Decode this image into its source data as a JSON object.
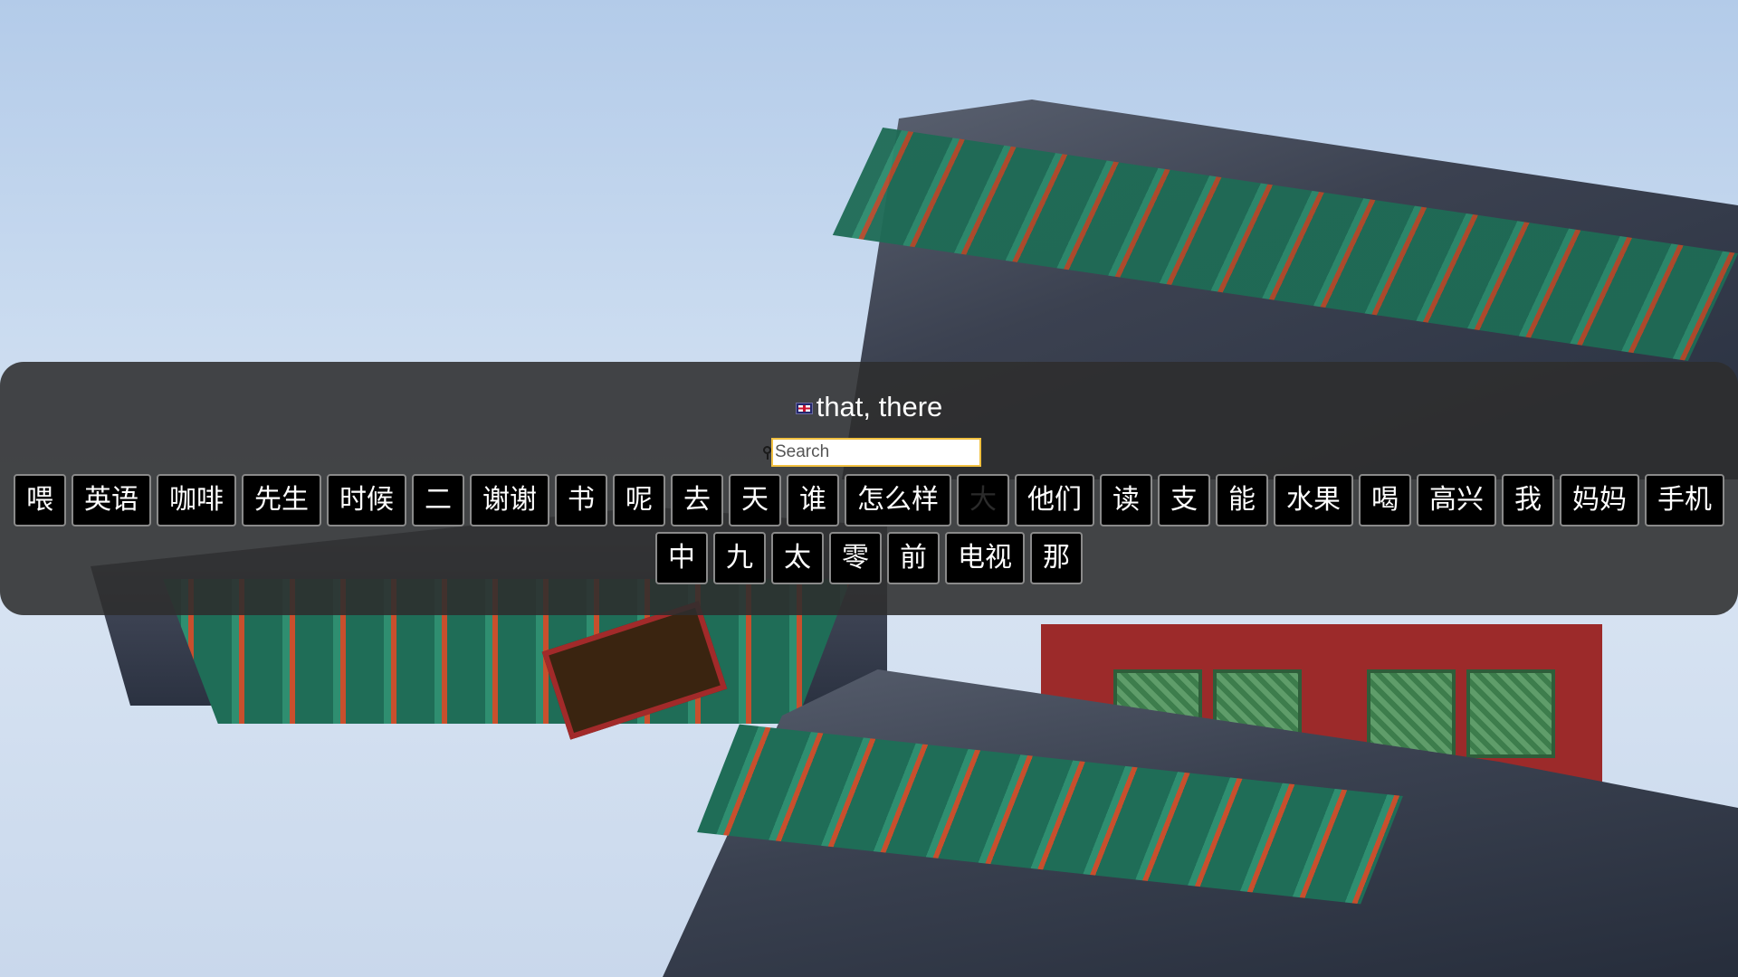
{
  "meaning": {
    "text": "that, there",
    "flag_icon": "uk-flag-icon"
  },
  "search": {
    "placeholder": "Search",
    "value": ""
  },
  "words_row1": [
    {
      "label": "喂"
    },
    {
      "label": "英语"
    },
    {
      "label": "咖啡"
    },
    {
      "label": "先生"
    },
    {
      "label": "时候"
    },
    {
      "label": "二"
    },
    {
      "label": "谢谢"
    },
    {
      "label": "书"
    },
    {
      "label": "呢"
    },
    {
      "label": "去"
    },
    {
      "label": "天"
    },
    {
      "label": "谁"
    },
    {
      "label": "怎么样"
    },
    {
      "label": "大",
      "dimmed": true
    },
    {
      "label": "他们"
    },
    {
      "label": "读"
    },
    {
      "label": "支"
    },
    {
      "label": "能"
    },
    {
      "label": "水果"
    },
    {
      "label": "喝"
    },
    {
      "label": "高兴"
    },
    {
      "label": "我"
    },
    {
      "label": "妈妈"
    },
    {
      "label": "手机"
    }
  ],
  "words_row2": [
    {
      "label": "中"
    },
    {
      "label": "九"
    },
    {
      "label": "太"
    },
    {
      "label": "零"
    },
    {
      "label": "前"
    },
    {
      "label": "电视"
    },
    {
      "label": "那"
    }
  ],
  "colors": {
    "panel": "#2d2d2d",
    "button_bg": "#000000",
    "button_border": "#8a8a8a",
    "search_border": "#f1c040"
  }
}
